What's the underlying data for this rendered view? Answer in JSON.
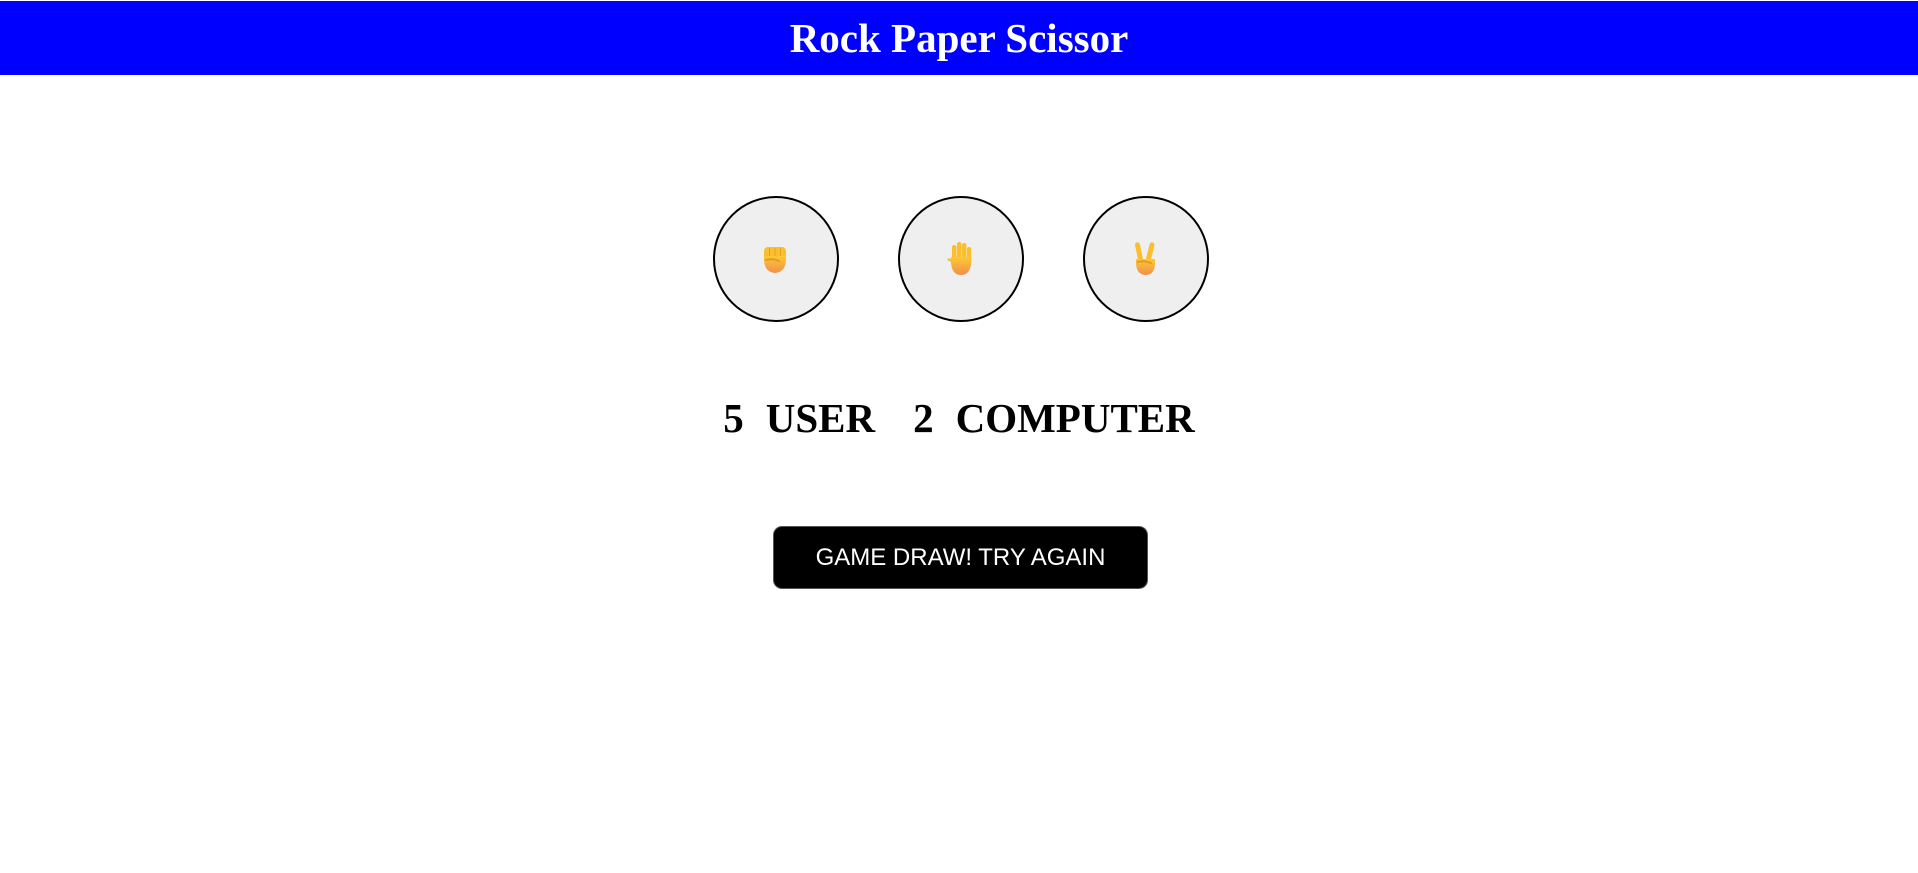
{
  "header": {
    "title": "Rock Paper Scissor",
    "background": "#0000ff",
    "text_color": "#ffffff"
  },
  "choices": [
    {
      "id": "rock",
      "icon": "raised-fist-icon"
    },
    {
      "id": "paper",
      "icon": "raised-hand-icon"
    },
    {
      "id": "scissors",
      "icon": "victory-hand-icon"
    }
  ],
  "scoreboard": {
    "user_score": "5",
    "user_label": "USER",
    "computer_score": "2",
    "computer_label": "COMPUTER"
  },
  "message": {
    "text": "GAME DRAW! TRY AGAIN",
    "background": "#000000",
    "text_color": "#ffffff"
  },
  "colors": {
    "choice_background": "#efefef",
    "choice_border": "#000000",
    "hand_skin": "#fbbf2d",
    "hand_shade": "#f28f4a"
  }
}
